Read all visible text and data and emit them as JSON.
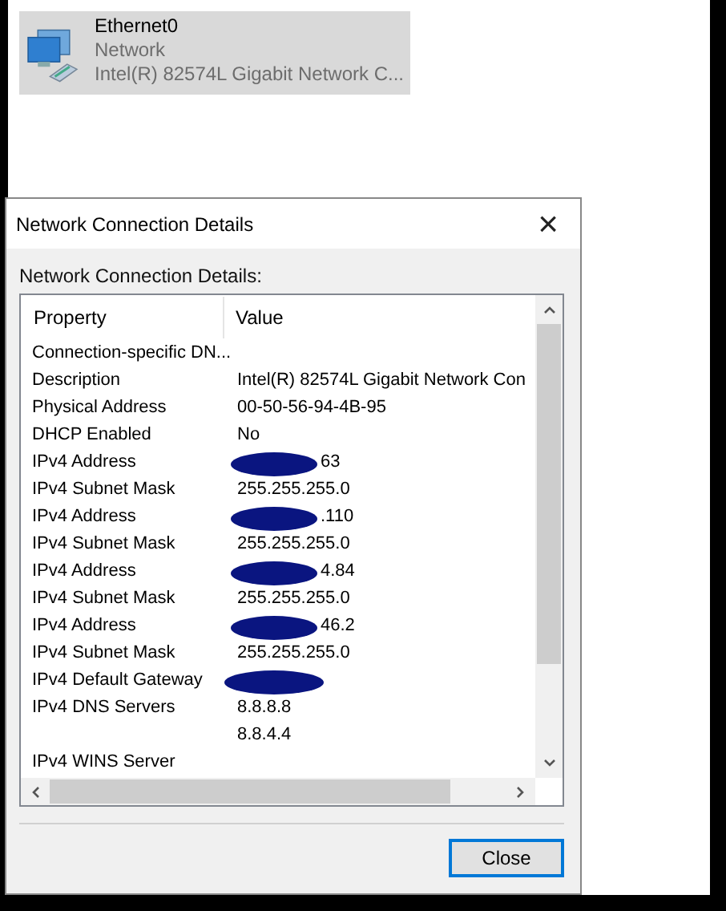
{
  "adapter": {
    "name": "Ethernet0",
    "network": "Network",
    "device": "Intel(R) 82574L Gigabit Network C...",
    "selected": true
  },
  "dialog": {
    "title": "Network Connection Details",
    "close_glyph": "×",
    "label": "Network Connection Details:",
    "columns": [
      "Property",
      "Value"
    ],
    "rows": [
      {
        "property": "Connection-specific DN...",
        "value": "",
        "redacted": false
      },
      {
        "property": "Description",
        "value": "Intel(R) 82574L Gigabit Network Con",
        "redacted": false
      },
      {
        "property": "Physical Address",
        "value": "00-50-56-94-4B-95",
        "redacted": false
      },
      {
        "property": "DHCP Enabled",
        "value": "No",
        "redacted": false
      },
      {
        "property": "IPv4 Address",
        "value": "63",
        "redacted": true
      },
      {
        "property": "IPv4 Subnet Mask",
        "value": "255.255.255.0",
        "redacted": false
      },
      {
        "property": "IPv4 Address",
        "value": ".110",
        "redacted": true
      },
      {
        "property": "IPv4 Subnet Mask",
        "value": "255.255.255.0",
        "redacted": false
      },
      {
        "property": "IPv4 Address",
        "value": "4.84",
        "redacted": true
      },
      {
        "property": "IPv4 Subnet Mask",
        "value": "255.255.255.0",
        "redacted": false
      },
      {
        "property": "IPv4 Address",
        "value": "46.2",
        "redacted": true
      },
      {
        "property": "IPv4 Subnet Mask",
        "value": "255.255.255.0",
        "redacted": false
      },
      {
        "property": "IPv4 Default Gateway",
        "value": "",
        "redacted": true
      },
      {
        "property": "IPv4 DNS Servers",
        "value": "8.8.8.8",
        "redacted": false
      },
      {
        "property": "",
        "value": "8.8.4.4",
        "redacted": false
      },
      {
        "property": "IPv4 WINS Server",
        "value": "",
        "redacted": false
      }
    ],
    "button": "Close"
  }
}
